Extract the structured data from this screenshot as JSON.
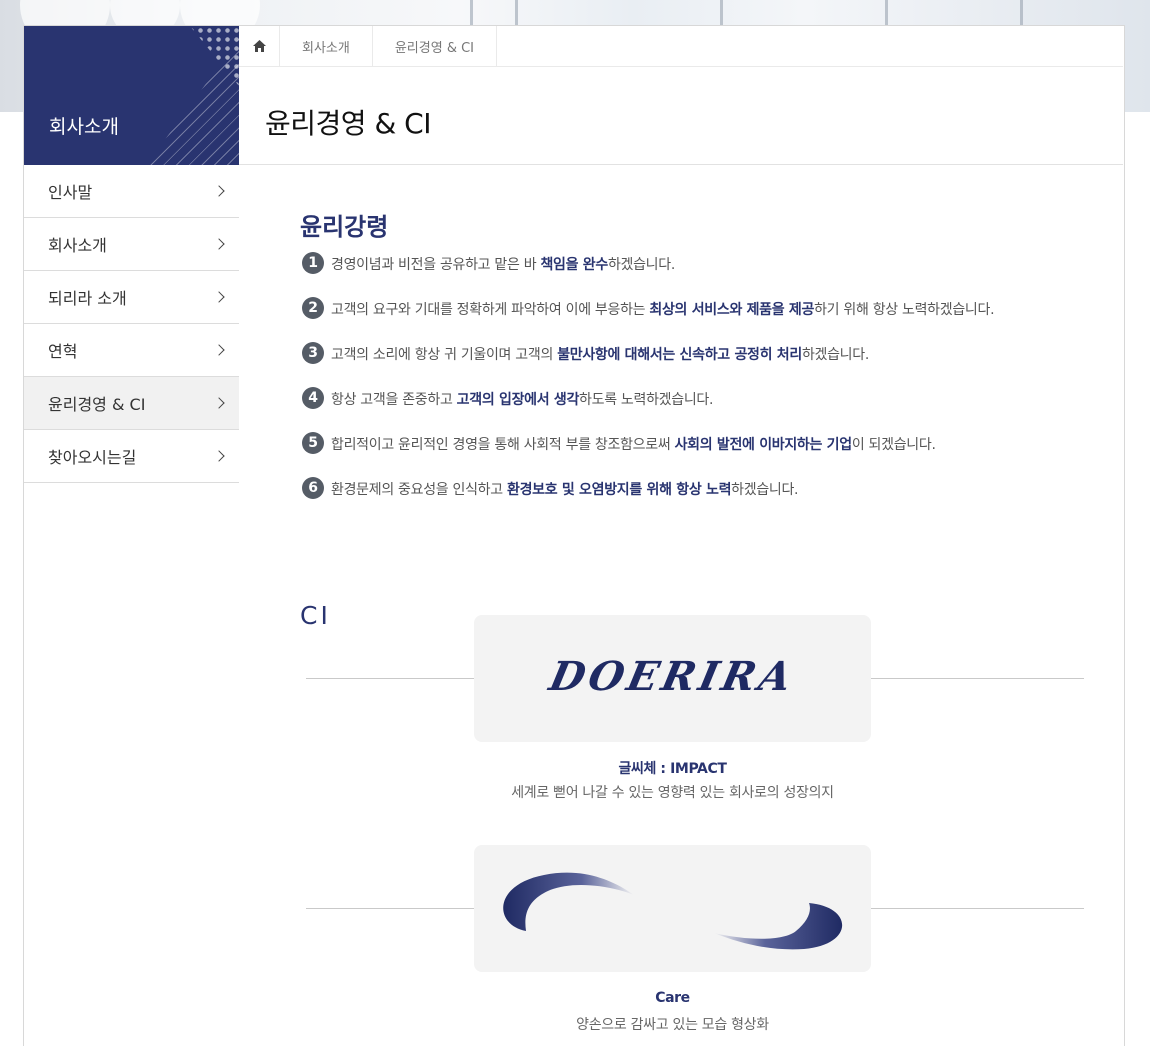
{
  "sidebar": {
    "title": "회사소개",
    "items": [
      {
        "label": "인사말"
      },
      {
        "label": "회사소개"
      },
      {
        "label": "되리라 소개"
      },
      {
        "label": "연혁"
      },
      {
        "label": "윤리경영 & CI"
      },
      {
        "label": "찾아오시는길"
      }
    ],
    "active_index": 4
  },
  "breadcrumb": {
    "home_icon": "home-icon",
    "items": [
      "회사소개",
      "윤리경영 & CI"
    ]
  },
  "page_title": "윤리경영 & CI",
  "ethics": {
    "title": "윤리강령",
    "items": [
      {
        "num": "1",
        "pre": "경영이념과 비전을 공유하고 맡은 바 ",
        "bold": "책임을 완수",
        "post": "하겠습니다."
      },
      {
        "num": "2",
        "pre": "고객의 요구와 기대를 정확하게 파악하여 이에 부응하는 ",
        "bold": "최상의 서비스와 제품을 제공",
        "post": "하기 위해 항상 노력하겠습니다."
      },
      {
        "num": "3",
        "pre": "고객의 소리에 항상 귀 기울이며 고객의 ",
        "bold": "불만사항에 대해서는 신속하고 공정히 처리",
        "post": "하겠습니다."
      },
      {
        "num": "4",
        "pre": "항상 고객을 존중하고 ",
        "bold": "고객의 입장에서 생각",
        "post": "하도록 노력하겠습니다."
      },
      {
        "num": "5",
        "pre": "합리적이고 윤리적인 경영을 통해 사회적 부를 창조함으로써 ",
        "bold": "사회의 발전에 이바지하는 기업",
        "post": "이 되겠습니다."
      },
      {
        "num": "6",
        "pre": "환경문제의 중요성을 인식하고 ",
        "bold": "환경보호 및 오염방지를 위해 항상 노력",
        "post": "하겠습니다."
      }
    ]
  },
  "ci": {
    "title": "CI",
    "logo": {
      "text": "DOERIRA",
      "caption_title": "글씨체 : IMPACT",
      "caption_desc": "세계로 뻗어 나갈 수 있는 영향력 있는 회사로의 성장의지"
    },
    "symbol": {
      "icon": "swoosh-symbol-icon",
      "caption_title": "Care",
      "caption_desc": "양손으로 감싸고 있는 모습 형상화"
    }
  },
  "colors": {
    "brand": "#293470",
    "active_bg": "#f1f1f1"
  }
}
